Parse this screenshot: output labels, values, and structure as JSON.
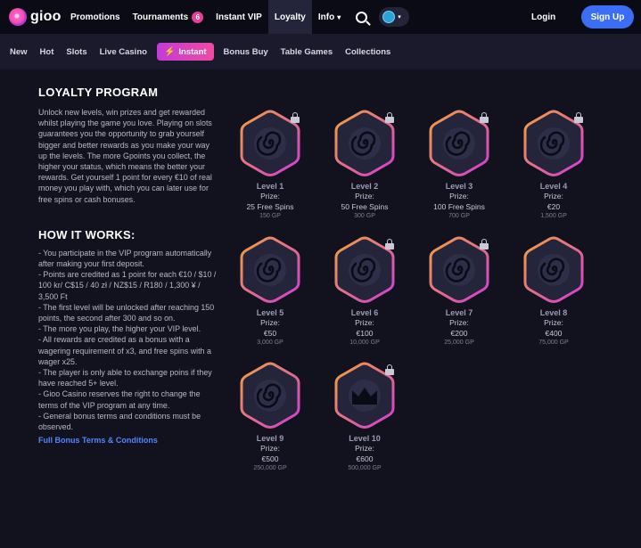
{
  "topnav": {
    "logo_text": "gioo",
    "items": [
      {
        "label": "Promotions"
      },
      {
        "label": "Tournaments",
        "badge": "6"
      },
      {
        "label": "Instant VIP"
      },
      {
        "label": "Loyalty"
      },
      {
        "label": "Info"
      }
    ],
    "login_label": "Login",
    "signup_label": "Sign Up"
  },
  "subnav": {
    "items": [
      "New",
      "Hot",
      "Slots",
      "Live Casino",
      "Instant",
      "Bonus Buy",
      "Table Games",
      "Collections"
    ]
  },
  "loyalty": {
    "title": "LOYALTY PROGRAM",
    "intro": "Unlock new levels, win prizes and get rewarded whilst playing the game you love. Playing on slots guarantees you the opportunity to grab yourself bigger and better rewards as you make your way up the levels. The more Gpoints you collect, the higher your status, which means the better your rewards. Get yourself 1 point for every €10 of real money you play with, which you can later use for free spins or cash bonuses.",
    "how_title": "HOW IT WORKS:",
    "how_text": "- You participate in the VIP program automatically after making your first deposit.\n- Points are credited as 1 point for each €10 / $10 / 100 kr/ C$15 / 40 zł / NZ$15 / R180 / 1,300 ¥ / 3,500 Ft\n- The first level will be unlocked after reaching 150 points, the second after 300 and so on.\n- The more you play, the higher your VIP level.\n- All rewards are credited as a bonus with a wagering requirement of x3, and free spins with a wager x25.\n- The player is only able to exchange poins if they have reached 5+ level.\n- Gioo Casino reserves the right to change the terms of the VIP program at any time.\n- General bonus terms and conditions must be observed.",
    "terms_link": "Full Bonus Terms & Conditions"
  },
  "levels": [
    {
      "name": "Level 1",
      "prize_label": "Prize:",
      "prize": "25 Free Spins",
      "gp": "150 GP",
      "icon": "spiral",
      "locked": true
    },
    {
      "name": "Level 2",
      "prize_label": "Prize:",
      "prize": "50 Free Spins",
      "gp": "300 GP",
      "icon": "spiral",
      "locked": true
    },
    {
      "name": "Level 3",
      "prize_label": "Prize:",
      "prize": "100 Free Spins",
      "gp": "700 GP",
      "icon": "spiral",
      "locked": true
    },
    {
      "name": "Level 4",
      "prize_label": "Prize:",
      "prize": "€20",
      "gp": "1,500 GP",
      "icon": "spiral",
      "locked": true
    },
    {
      "name": "Level 5",
      "prize_label": "Prize:",
      "prize": "€50",
      "gp": "3,000 GP",
      "icon": "spiral",
      "locked": false
    },
    {
      "name": "Level 6",
      "prize_label": "Prize:",
      "prize": "€100",
      "gp": "10,000 GP",
      "icon": "spiral",
      "locked": true
    },
    {
      "name": "Level 7",
      "prize_label": "Prize:",
      "prize": "€200",
      "gp": "25,000 GP",
      "icon": "spiral",
      "locked": true
    },
    {
      "name": "Level 8",
      "prize_label": "Prize:",
      "prize": "€400",
      "gp": "75,000 GP",
      "icon": "spiral",
      "locked": false
    },
    {
      "name": "Level 9",
      "prize_label": "Prize:",
      "prize": "€500",
      "gp": "250,000 GP",
      "icon": "spiral",
      "locked": false
    },
    {
      "name": "Level 10",
      "prize_label": "Prize:",
      "prize": "€600",
      "gp": "500,000 GP",
      "icon": "crown",
      "locked": true
    }
  ],
  "colors": {
    "accent": "#3b6df5",
    "instant_gradient_start": "#c23ad8",
    "instant_gradient_end": "#f04aa2",
    "hex_border_start": "#f2a23c",
    "hex_border_end": "#d33ad8"
  }
}
